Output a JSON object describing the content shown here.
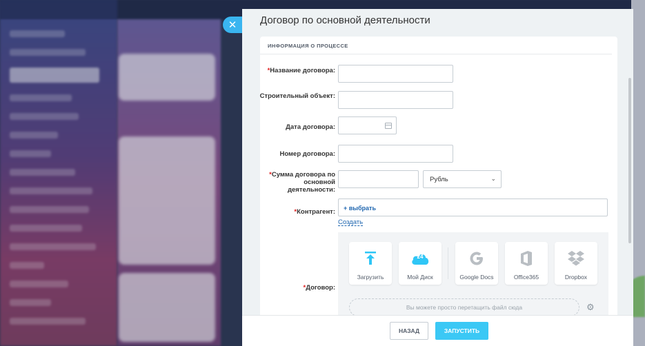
{
  "panel": {
    "title": "Договор по основной деятельности",
    "close_icon": "close-icon",
    "section_title": "ИНФОРМАЦИЯ О ПРОЦЕССЕ"
  },
  "fields": {
    "contract_name": {
      "required_mark": "*",
      "label": "Название договора:",
      "value": ""
    },
    "construction_site": {
      "label": "Строительный объект:",
      "value": ""
    },
    "contract_date": {
      "label": "Дата договора:",
      "value": "",
      "icon": "calendar-icon"
    },
    "contract_number": {
      "label": "Номер договора:",
      "value": ""
    },
    "contract_amount": {
      "required_mark": "*",
      "label": "Сумма договора по основной деятельности:",
      "value": "",
      "currency": "Рубль"
    },
    "counterparty": {
      "required_mark": "*",
      "label": "Контрагент:",
      "select_label": "+ выбрать",
      "create_label": "Создать"
    },
    "contract_file": {
      "required_mark": "*",
      "label": "Договор:",
      "sources": [
        {
          "label": "Загрузить",
          "icon": "upload-icon"
        },
        {
          "label": "Мой Диск",
          "icon": "my-drive-icon",
          "badge": "24"
        },
        {
          "label": "Google Docs",
          "icon": "google-docs-icon"
        },
        {
          "label": "Office365",
          "icon": "office365-icon"
        },
        {
          "label": "Dropbox",
          "icon": "dropbox-icon"
        }
      ],
      "dropzone_text": "Вы можете просто перетащить файл сюда",
      "settings_icon": "gear-icon"
    }
  },
  "footer": {
    "back_label": "НАЗАД",
    "run_label": "ЗАПУСТИТЬ"
  },
  "colors": {
    "accent": "#3bc8f5",
    "link": "#2067b0",
    "required": "#e02020"
  }
}
